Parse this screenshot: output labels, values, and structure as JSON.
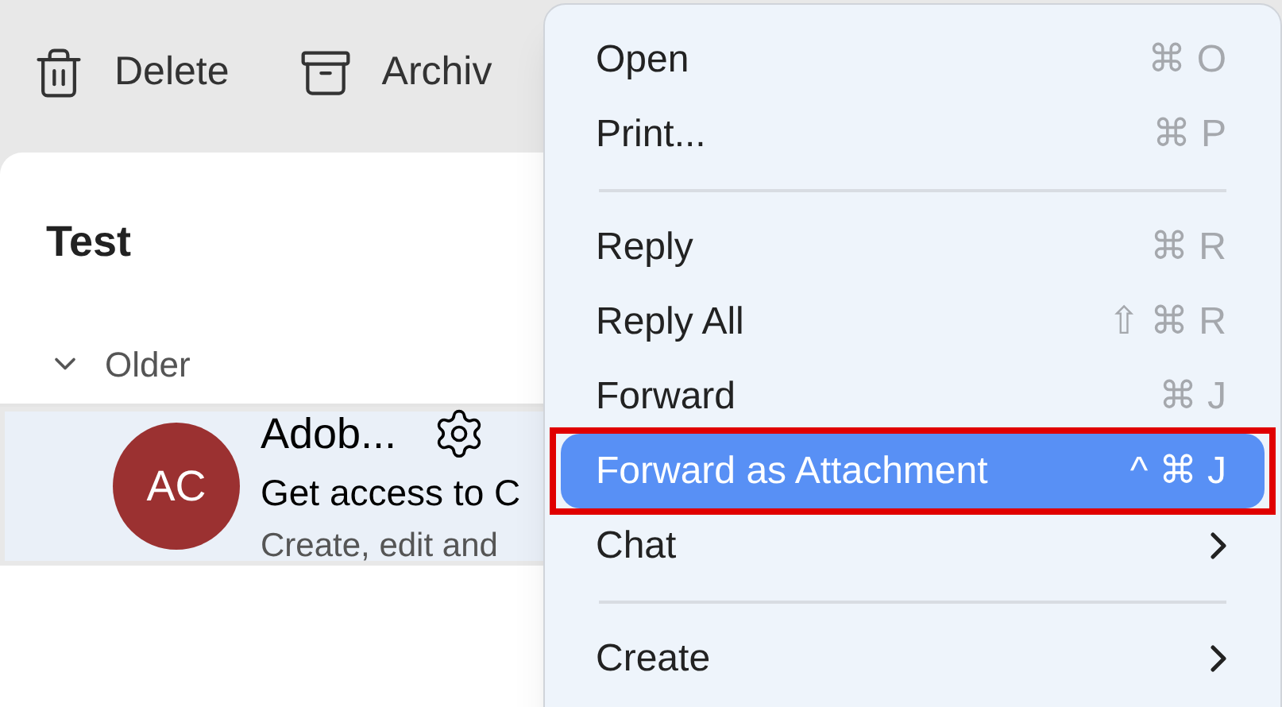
{
  "toolbar": {
    "buttons": [
      {
        "label": "Delete",
        "kind": "trash"
      },
      {
        "label": "Archiv",
        "kind": "archive"
      }
    ]
  },
  "folder": {
    "title": "Test",
    "group": {
      "label": "Older",
      "expanded": true
    },
    "messages": [
      {
        "initials": "AC",
        "color": "#9b3131",
        "sender": "Adob...",
        "subject": "Get access to C",
        "preview": "Create, edit and",
        "selected": true
      }
    ]
  },
  "context_menu": {
    "items": [
      {
        "kind": "item",
        "label": "Open",
        "shortcut": "⌘ O",
        "selected": false
      },
      {
        "kind": "item",
        "label": "Print...",
        "shortcut": "⌘ P",
        "selected": false
      },
      {
        "kind": "separator"
      },
      {
        "kind": "item",
        "label": "Reply",
        "shortcut": "⌘ R",
        "selected": false
      },
      {
        "kind": "item",
        "label": "Reply All",
        "shortcut": "⇧ ⌘ R",
        "selected": false
      },
      {
        "kind": "item",
        "label": "Forward",
        "shortcut": "⌘ J",
        "selected": false
      },
      {
        "kind": "item",
        "label": "Forward as Attachment",
        "shortcut": "^ ⌘ J",
        "selected": true,
        "outlined": true
      },
      {
        "kind": "submenu",
        "label": "Chat",
        "selected": false
      },
      {
        "kind": "separator"
      },
      {
        "kind": "submenu",
        "label": "Create",
        "selected": false
      }
    ]
  }
}
